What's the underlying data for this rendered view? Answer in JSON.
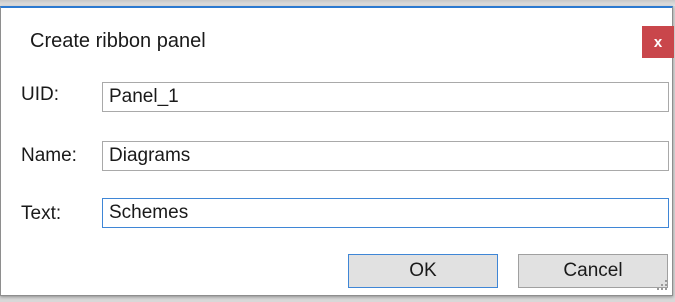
{
  "dialog": {
    "title": "Create ribbon panel",
    "close_label": "x"
  },
  "fields": [
    {
      "label": "UID:",
      "value": "Panel_1"
    },
    {
      "label": "Name:",
      "value": "Diagrams"
    },
    {
      "label": "Text:",
      "value": "Schemes"
    }
  ],
  "buttons": {
    "ok_label": "OK",
    "cancel_label": "Cancel"
  },
  "colors": {
    "close_button": "#c9464b",
    "focus_border": "#3f86d6"
  }
}
